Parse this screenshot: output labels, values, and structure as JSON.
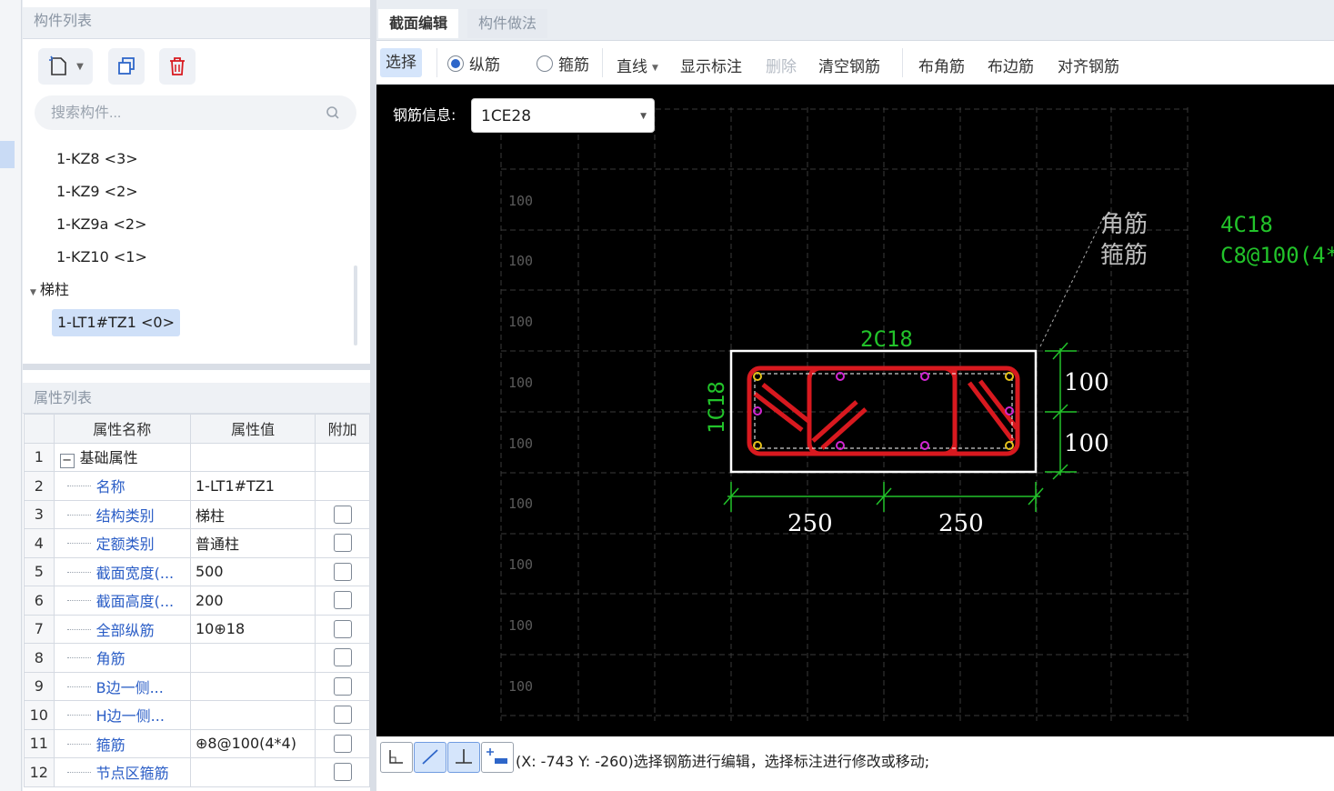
{
  "component_list": {
    "header": "构件列表",
    "search_placeholder": "搜索构件...",
    "items": [
      {
        "label": "1-KZ8 <3>"
      },
      {
        "label": "1-KZ9 <2>"
      },
      {
        "label": "1-KZ9a <2>"
      },
      {
        "label": "1-KZ10 <1>"
      }
    ],
    "group": {
      "label": "梯柱",
      "items": [
        {
          "label": "1-LT1#TZ1 <0>",
          "selected": true
        }
      ]
    }
  },
  "property_list": {
    "header": "属性列表",
    "columns": [
      "属性名称",
      "属性值",
      "附加"
    ],
    "rows": [
      {
        "num": "1",
        "name": "基础属性",
        "value": "",
        "group": true
      },
      {
        "num": "2",
        "name": "名称",
        "value": "1-LT1#TZ1",
        "has_check": false
      },
      {
        "num": "3",
        "name": "结构类别",
        "value": "梯柱",
        "has_check": true
      },
      {
        "num": "4",
        "name": "定额类别",
        "value": "普通柱",
        "has_check": true
      },
      {
        "num": "5",
        "name": "截面宽度(...",
        "value": "500",
        "has_check": true
      },
      {
        "num": "6",
        "name": "截面高度(...",
        "value": "200",
        "has_check": true
      },
      {
        "num": "7",
        "name": "全部纵筋",
        "value": "10⊕18",
        "has_check": true
      },
      {
        "num": "8",
        "name": "角筋",
        "value": "",
        "has_check": true
      },
      {
        "num": "9",
        "name": "B边一侧...",
        "value": "",
        "has_check": true
      },
      {
        "num": "10",
        "name": "H边一侧...",
        "value": "",
        "has_check": true
      },
      {
        "num": "11",
        "name": "箍筋",
        "value": "⊕8@100(4*4)",
        "has_check": true
      },
      {
        "num": "12",
        "name": "节点区箍筋",
        "value": "",
        "has_check": true
      }
    ]
  },
  "tabs": [
    {
      "label": "截面编辑",
      "active": true
    },
    {
      "label": "构件做法",
      "active": false
    }
  ],
  "toolbar": {
    "select": "选择",
    "longitudinal": "纵筋",
    "stirrup": "箍筋",
    "line": "直线",
    "show_annotation": "显示标注",
    "delete": "删除",
    "clear_rebar": "清空钢筋",
    "corner_rebar": "布角筋",
    "edge_rebar": "布边筋",
    "align_rebar": "对齐钢筋"
  },
  "canvas": {
    "rebar_info_label": "钢筋信息:",
    "rebar_info_value": "1CE28",
    "grid_label": "100",
    "top_label": "2C18",
    "side_label": "1C18",
    "corner_text": "角筋",
    "stirrup_text": "箍筋",
    "corner_value": "4C18",
    "stirrup_value": "C8@100(4*",
    "dim_h1": "100",
    "dim_h2": "100",
    "dim_b1": "250",
    "dim_b2": "250",
    "colors": {
      "accent_green": "#22c32a",
      "rebar_red": "#d8191f",
      "white": "#ffffff"
    }
  },
  "status": {
    "text": "(X: -743 Y: -260)选择钢筋进行编辑，选择标注进行修改或移动;"
  }
}
